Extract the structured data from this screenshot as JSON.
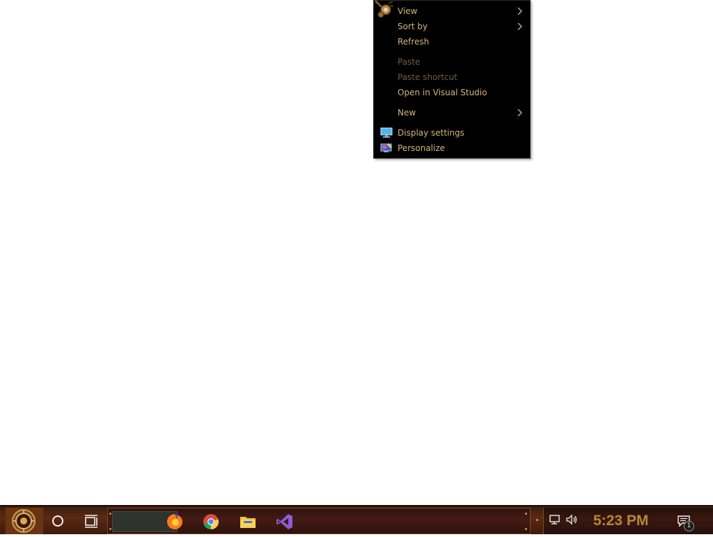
{
  "context_menu": {
    "items": [
      {
        "label": "View",
        "submenu": true,
        "enabled": true
      },
      {
        "label": "Sort by",
        "submenu": true,
        "enabled": true
      },
      {
        "label": "Refresh",
        "submenu": false,
        "enabled": true
      },
      {
        "label": "Paste",
        "submenu": false,
        "enabled": false
      },
      {
        "label": "Paste shortcut",
        "submenu": false,
        "enabled": false
      },
      {
        "label": "Open in Visual Studio",
        "submenu": false,
        "enabled": true
      },
      {
        "label": "New",
        "submenu": true,
        "enabled": true
      },
      {
        "label": "Display settings",
        "icon": "display-icon",
        "enabled": true
      },
      {
        "label": "Personalize",
        "icon": "personalize-icon",
        "enabled": true
      }
    ],
    "colors": {
      "background": "#000000",
      "text": "#d4b57a",
      "disabled": "#6e5c40"
    }
  },
  "taskbar": {
    "start_icon": "steampunk-gear-start-icon",
    "search_icon": "cortana-circle-icon",
    "taskview_icon": "task-view-icon",
    "pinned_apps": [
      {
        "name": "Firefox",
        "icon": "firefox-icon"
      },
      {
        "name": "Google Chrome",
        "icon": "chrome-icon"
      },
      {
        "name": "File Explorer",
        "icon": "folder-icon"
      },
      {
        "name": "Visual Studio",
        "icon": "visual-studio-icon"
      }
    ],
    "tray": {
      "icons": [
        "show-hidden-icons-icon",
        "network-icon",
        "volume-icon"
      ],
      "clock": "5:23 PM",
      "notification_count": "1"
    },
    "colors": {
      "accent": "#b8843c",
      "frame": "#7a4a26"
    }
  }
}
